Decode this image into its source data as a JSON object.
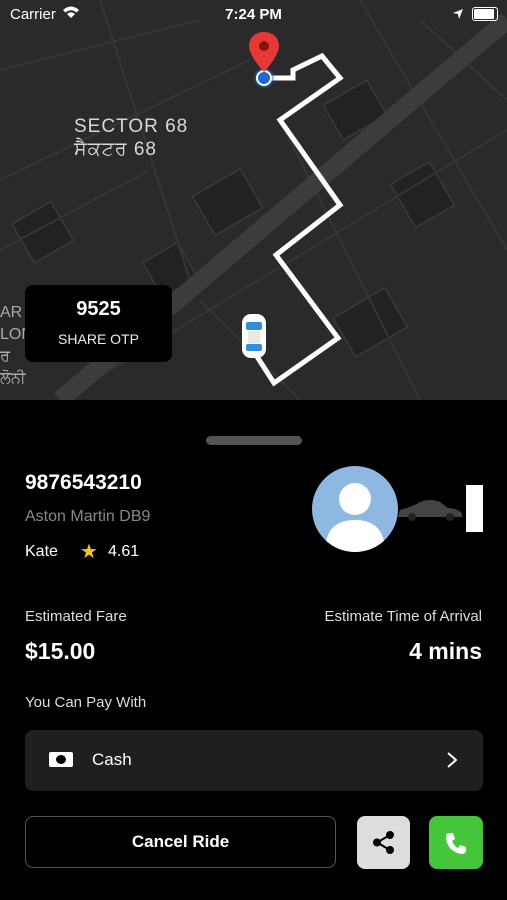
{
  "status_bar": {
    "carrier": "Carrier",
    "time": "7:24 PM"
  },
  "map": {
    "sector_en": "SECTOR 68",
    "sector_pa": "ਸੈਕਟਰ 68",
    "edge_text_line1": "AR",
    "edge_text_line2": "LON",
    "edge_text_line3": "ਰ",
    "edge_text_line4": "ਲੋਨੀ",
    "route_color": "#ffffff",
    "pin_color": "#e53935"
  },
  "otp": {
    "code": "9525",
    "label": "SHARE OTP"
  },
  "driver": {
    "phone": "9876543210",
    "car": "Aston Martin DB9",
    "name": "Kate",
    "rating": "4.61"
  },
  "trip": {
    "fare_label": "Estimated Fare",
    "fare": "$15.00",
    "eta_label": "Estimate Time of Arrival",
    "eta": "4 mins"
  },
  "payment": {
    "label": "You Can Pay With",
    "method": "Cash"
  },
  "actions": {
    "cancel": "Cancel Ride"
  },
  "colors": {
    "call_green": "#44c53c",
    "star": "#f5c518",
    "avatar_bg": "#8eb7e2"
  }
}
